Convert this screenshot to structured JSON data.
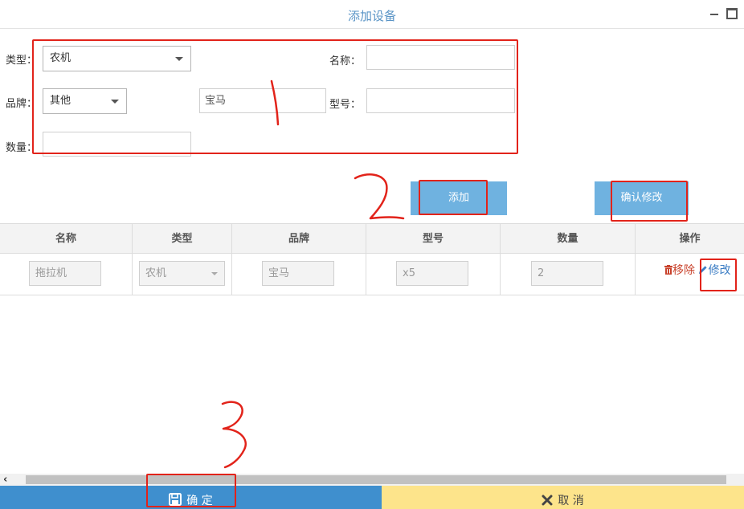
{
  "window": {
    "title": "添加设备"
  },
  "form": {
    "type_label": "类型：",
    "type_value": "农机",
    "name_label": "名称：",
    "name_value": "",
    "brand_label": "品牌：",
    "brand_value": "其他",
    "brand_custom_value": "宝马",
    "model_label": "型号：",
    "model_value": "",
    "qty_label": "数量：",
    "qty_value": ""
  },
  "actions": {
    "add_label": "添加",
    "confirm_edit_label": "确认修改"
  },
  "table": {
    "headers": [
      "名称",
      "类型",
      "品牌",
      "型号",
      "数量",
      "操作"
    ],
    "rows": [
      {
        "name": "拖拉机",
        "type": "农机",
        "brand": "宝马",
        "model": "x5",
        "qty": "2",
        "remove_label": "移除",
        "edit_label": "修改"
      }
    ]
  },
  "scrollbar": {
    "left_arrow": "‹"
  },
  "footer": {
    "ok_label": "确 定",
    "cancel_label": "取 消"
  },
  "annotations": {
    "mark_1": "1",
    "mark_2": "2",
    "mark_3": "3"
  },
  "colors": {
    "annotation_red": "#e2231a",
    "accent_blue": "#3f8fce",
    "cancel_yellow": "#fde48b",
    "title_blue": "#5a94c6"
  }
}
